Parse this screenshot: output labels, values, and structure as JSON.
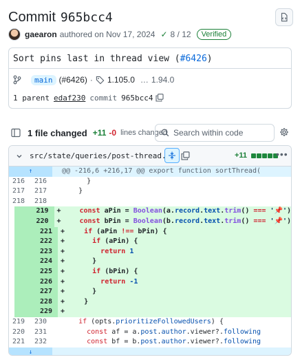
{
  "header": {
    "title_word": "Commit",
    "sha": "965bcc4"
  },
  "meta": {
    "author": "gaearon",
    "authored_text": "authored on Nov 17, 2024",
    "checks": "8 / 12",
    "verified": "Verified"
  },
  "commit": {
    "message": "Sort pins last in thread view (",
    "pr_link": "#6426",
    "message_end": ")",
    "branch": "main",
    "branch_pr": "(#6426)",
    "tag": "1.105.0",
    "tag_ellipsis": "…",
    "tag_prev": "1.94.0",
    "parent_label": "1 parent",
    "parent_sha": "edaf230",
    "commit_label": "commit",
    "commit_sha": "965bcc4"
  },
  "files_bar": {
    "files_changed": "1 file changed",
    "additions": "+11",
    "deletions": "-0",
    "lines_changed": "lines changed",
    "search_placeholder": "Search within code"
  },
  "file": {
    "path": "src/state/queries/post-thread.ts",
    "additions": "+11",
    "diffstat_blocks": 5,
    "hunk_header": "@@ -216,6 +216,17 @@ export function sortThread("
  },
  "diff_lines": [
    {
      "old": "216",
      "new": "216",
      "sign": "",
      "type": "ctx",
      "text": "      }"
    },
    {
      "old": "217",
      "new": "217",
      "sign": "",
      "type": "ctx",
      "text": "    }"
    },
    {
      "old": "218",
      "new": "218",
      "sign": "",
      "type": "ctx",
      "text": ""
    },
    {
      "old": "",
      "new": "219",
      "sign": "+",
      "type": "add",
      "text": "    const aPin = Boolean(a.record.text.trim() === '📌')"
    },
    {
      "old": "",
      "new": "220",
      "sign": "+",
      "type": "add",
      "text": "    const bPin = Boolean(b.record.text.trim() === '📌')"
    },
    {
      "old": "",
      "new": "221",
      "sign": "+",
      "type": "add",
      "text": "    if (aPin !== bPin) {"
    },
    {
      "old": "",
      "new": "222",
      "sign": "+",
      "type": "add",
      "text": "      if (aPin) {"
    },
    {
      "old": "",
      "new": "223",
      "sign": "+",
      "type": "add",
      "text": "        return 1"
    },
    {
      "old": "",
      "new": "224",
      "sign": "+",
      "type": "add",
      "text": "      }"
    },
    {
      "old": "",
      "new": "225",
      "sign": "+",
      "type": "add",
      "text": "      if (bPin) {"
    },
    {
      "old": "",
      "new": "226",
      "sign": "+",
      "type": "add",
      "text": "        return -1"
    },
    {
      "old": "",
      "new": "227",
      "sign": "+",
      "type": "add",
      "text": "      }"
    },
    {
      "old": "",
      "new": "228",
      "sign": "+",
      "type": "add",
      "text": "    }"
    },
    {
      "old": "",
      "new": "229",
      "sign": "+",
      "type": "add",
      "text": ""
    },
    {
      "old": "219",
      "new": "230",
      "sign": "",
      "type": "ctx",
      "text": "    if (opts.prioritizeFollowedUsers) {"
    },
    {
      "old": "220",
      "new": "231",
      "sign": "",
      "type": "ctx",
      "text": "      const af = a.post.author.viewer?.following"
    },
    {
      "old": "221",
      "new": "232",
      "sign": "",
      "type": "ctx",
      "text": "      const bf = b.post.author.viewer?.following"
    }
  ],
  "colors": {
    "add_green": "#1a7f37",
    "del_red": "#d1242f",
    "link_blue": "#0969da",
    "add_bg": "#dafbe1",
    "add_num_bg": "#aceebb",
    "hunk_bg": "#ddf4ff"
  }
}
